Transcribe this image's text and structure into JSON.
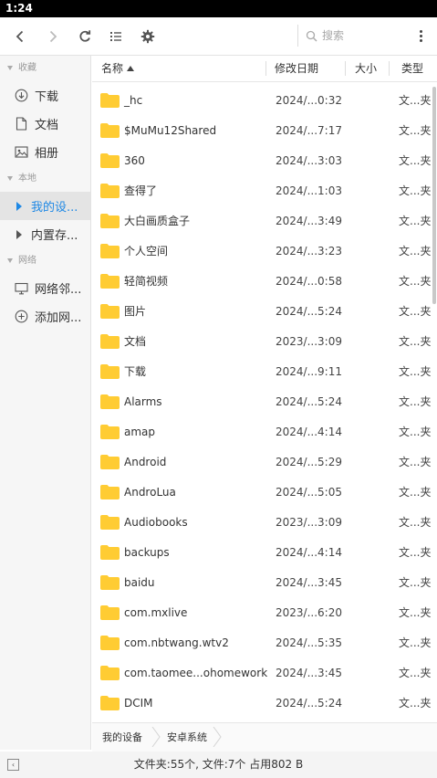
{
  "statusbar": {
    "time": "1:24"
  },
  "toolbar": {
    "back_icon": "chevron-left-icon",
    "forward_icon": "chevron-right-icon",
    "refresh_icon": "refresh-icon",
    "view_icon": "list-view-icon",
    "settings_icon": "gear-icon",
    "search_placeholder": "搜索",
    "more_icon": "more-vertical-icon"
  },
  "sidebar": {
    "sections": [
      {
        "label": "收藏",
        "items": [
          {
            "label": "下载",
            "icon": "download-icon"
          },
          {
            "label": "文档",
            "icon": "document-icon"
          },
          {
            "label": "相册",
            "icon": "image-icon"
          }
        ]
      },
      {
        "label": "本地",
        "items": [
          {
            "label": "我的设...",
            "icon": "expand-arrow-icon",
            "active": true
          },
          {
            "label": "内置存...",
            "icon": "expand-arrow-icon"
          }
        ]
      },
      {
        "label": "网络",
        "items": [
          {
            "label": "网络邻...",
            "icon": "monitor-icon"
          },
          {
            "label": "添加网...",
            "icon": "add-circle-icon"
          }
        ]
      }
    ]
  },
  "columns": {
    "name": "名称",
    "date": "修改日期",
    "size": "大小",
    "type": "类型"
  },
  "accent_color": "#1e88e5",
  "folder_color": "#ffcc33",
  "files": [
    {
      "name": "_hc",
      "date": "2024/...0:32",
      "type": "文...夹"
    },
    {
      "name": "$MuMu12Shared",
      "date": "2024/...7:17",
      "type": "文...夹"
    },
    {
      "name": "360",
      "date": "2024/...3:03",
      "type": "文...夹"
    },
    {
      "name": "查得了",
      "date": "2024/...1:03",
      "type": "文...夹"
    },
    {
      "name": "大白画质盒子",
      "date": "2024/...3:49",
      "type": "文...夹"
    },
    {
      "name": "个人空间",
      "date": "2024/...3:23",
      "type": "文...夹"
    },
    {
      "name": "轻简视频",
      "date": "2024/...0:58",
      "type": "文...夹"
    },
    {
      "name": "图片",
      "date": "2024/...5:24",
      "type": "文...夹"
    },
    {
      "name": "文档",
      "date": "2023/...3:09",
      "type": "文...夹"
    },
    {
      "name": "下载",
      "date": "2024/...9:11",
      "type": "文...夹"
    },
    {
      "name": "Alarms",
      "date": "2024/...5:24",
      "type": "文...夹"
    },
    {
      "name": "amap",
      "date": "2024/...4:14",
      "type": "文...夹"
    },
    {
      "name": "Android",
      "date": "2024/...5:29",
      "type": "文...夹"
    },
    {
      "name": "AndroLua",
      "date": "2024/...5:05",
      "type": "文...夹"
    },
    {
      "name": "Audiobooks",
      "date": "2023/...3:09",
      "type": "文...夹"
    },
    {
      "name": "backups",
      "date": "2024/...4:14",
      "type": "文...夹"
    },
    {
      "name": "baidu",
      "date": "2024/...3:45",
      "type": "文...夹"
    },
    {
      "name": "com.mxlive",
      "date": "2023/...6:20",
      "type": "文...夹"
    },
    {
      "name": "com.nbtwang.wtv2",
      "date": "2024/...5:35",
      "type": "文...夹"
    },
    {
      "name": "com.taomee...ohomework",
      "date": "2024/...3:45",
      "type": "文...夹"
    },
    {
      "name": "DCIM",
      "date": "2024/...5:24",
      "type": "文...夹"
    }
  ],
  "breadcrumbs": [
    "我的设备",
    "安卓系统"
  ],
  "bottombar": {
    "toggle_icon": "collapse-sidebar-icon",
    "summary": "文件夹:55个, 文件:7个 占用802 B"
  }
}
